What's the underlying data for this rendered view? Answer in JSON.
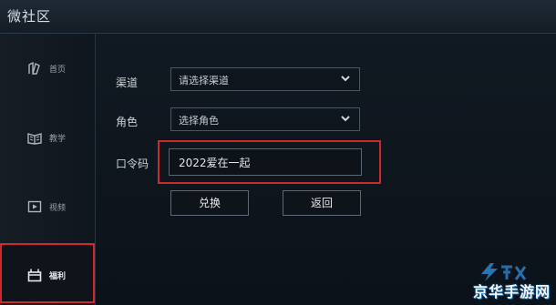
{
  "app": {
    "title": "微社区"
  },
  "sidebar": {
    "items": [
      {
        "label": "首页",
        "icon": "home-icon"
      },
      {
        "label": "教学",
        "icon": "book-icon"
      },
      {
        "label": "视频",
        "icon": "video-icon"
      },
      {
        "label": "福利",
        "icon": "gift-icon",
        "active": true
      }
    ]
  },
  "form": {
    "channel": {
      "label": "渠道",
      "value": "请选择渠道"
    },
    "role": {
      "label": "角色",
      "value": "选择角色"
    },
    "code": {
      "label": "口令码",
      "value": "2022爱在一起"
    }
  },
  "buttons": {
    "redeem": "兑换",
    "back": "返回"
  },
  "watermark": {
    "text": "京华手游网"
  },
  "colors": {
    "highlight": "#c92a2c",
    "background": "#0b1118",
    "accent_blue": "#1a6fb0"
  }
}
